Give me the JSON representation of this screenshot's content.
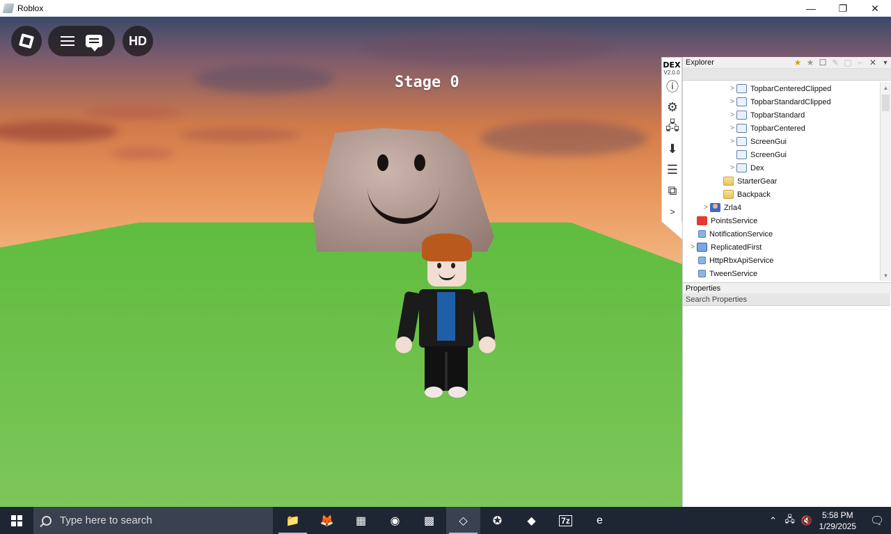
{
  "window": {
    "title": "Roblox",
    "controls": [
      "—",
      "❐",
      "✕"
    ]
  },
  "game": {
    "stage_label": "Stage 0"
  },
  "roblox_ui": {
    "hd_label": "HD"
  },
  "dex": {
    "brand": "DEX",
    "version": "V2.0.0",
    "side_icons": [
      "ⓘ",
      "⚙",
      "🖧",
      "⬇",
      "☰",
      "⧉",
      ">"
    ],
    "explorer_title": "Explorer",
    "tree": [
      {
        "label": "TopbarCenteredClipped",
        "indent": 3,
        "arrow": ">",
        "icon": "gui"
      },
      {
        "label": "TopbarStandardClipped",
        "indent": 3,
        "arrow": ">",
        "icon": "gui"
      },
      {
        "label": "TopbarStandard",
        "indent": 3,
        "arrow": ">",
        "icon": "gui"
      },
      {
        "label": "TopbarCentered",
        "indent": 3,
        "arrow": ">",
        "icon": "gui"
      },
      {
        "label": "ScreenGui",
        "indent": 3,
        "arrow": ">",
        "icon": "gui"
      },
      {
        "label": "ScreenGui",
        "indent": 3,
        "arrow": "",
        "icon": "gui"
      },
      {
        "label": "Dex",
        "indent": 3,
        "arrow": ">",
        "icon": "gui"
      },
      {
        "label": "StarterGear",
        "indent": 2,
        "arrow": "",
        "icon": "folder"
      },
      {
        "label": "Backpack",
        "indent": 2,
        "arrow": "",
        "icon": "folder"
      },
      {
        "label": "Zrla4",
        "indent": 1,
        "arrow": ">",
        "icon": "player"
      },
      {
        "label": "PointsService",
        "indent": 0,
        "arrow": "",
        "icon": "points"
      },
      {
        "label": "NotificationService",
        "indent": 0,
        "arrow": "",
        "icon": "svc"
      },
      {
        "label": "ReplicatedFirst",
        "indent": 0,
        "arrow": ">",
        "icon": "rep"
      },
      {
        "label": "HttpRbxApiService",
        "indent": 0,
        "arrow": "",
        "icon": "svc"
      },
      {
        "label": "TweenService",
        "indent": 0,
        "arrow": "",
        "icon": "svc"
      }
    ],
    "properties_title": "Properties",
    "properties_search_placeholder": "Search Properties"
  },
  "taskbar": {
    "search_placeholder": "Type here to search",
    "apps": [
      {
        "name": "file-explorer-icon",
        "glyph": "📁",
        "state": "running"
      },
      {
        "name": "firefox-icon",
        "glyph": "🦊",
        "state": ""
      },
      {
        "name": "game-launcher-icon",
        "glyph": "▦",
        "state": ""
      },
      {
        "name": "tor-browser-icon",
        "glyph": "◉",
        "state": ""
      },
      {
        "name": "script-editor-icon",
        "glyph": "▩",
        "state": ""
      },
      {
        "name": "roblox-icon",
        "glyph": "◇",
        "state": "active"
      },
      {
        "name": "star-app-icon",
        "glyph": "✪",
        "state": ""
      },
      {
        "name": "unity-icon",
        "glyph": "◆",
        "state": ""
      },
      {
        "name": "7zip-icon",
        "glyph": "7z",
        "state": ""
      },
      {
        "name": "internet-explorer-icon",
        "glyph": "e",
        "state": ""
      }
    ],
    "tray_icons": [
      "⌃",
      "🖧",
      "🔇"
    ],
    "time": "5:58 PM",
    "date": "1/29/2025",
    "notification_glyph": "🗨"
  }
}
